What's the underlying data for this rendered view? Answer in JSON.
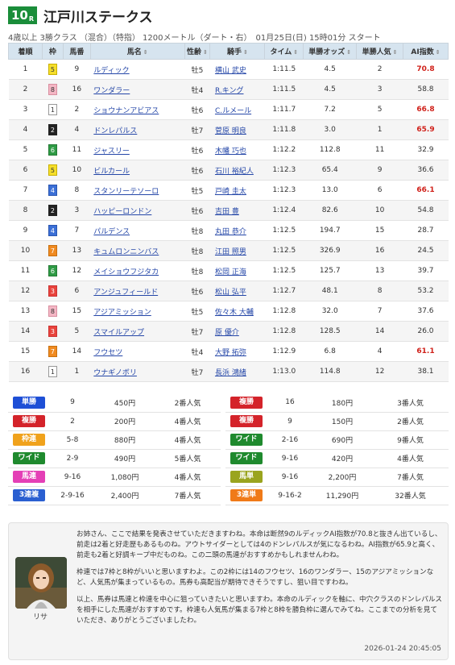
{
  "race": {
    "number": "10",
    "number_suffix": "R",
    "title": "江戸川ステークス",
    "info": "4歳以上 3勝クラス （混合）（特指） 1200メートル（ダート・右）　01月25日(日) 15時01分 スタート"
  },
  "table": {
    "headers": [
      "着順",
      "枠",
      "馬番",
      "馬名",
      "性齢",
      "騎手",
      "タイム",
      "単勝オッズ",
      "単勝人気",
      "AI指数"
    ],
    "sort_icon": "⇕",
    "rows": [
      {
        "pos": "1",
        "waku": "5",
        "num": "9",
        "name": "ルディック",
        "sex": "牡5",
        "jockey": "横山 武史",
        "time": "1:11.5",
        "odds": "4.5",
        "pop": "2",
        "ai": "70.8",
        "hi": true
      },
      {
        "pos": "2",
        "waku": "8",
        "num": "16",
        "name": "ワンダラー",
        "sex": "牡4",
        "jockey": "R.キング",
        "time": "1:11.5",
        "odds": "4.5",
        "pop": "3",
        "ai": "58.8",
        "hi": false
      },
      {
        "pos": "3",
        "waku": "1",
        "num": "2",
        "name": "ショウナンアビアス",
        "sex": "牡6",
        "jockey": "C.ルメール",
        "time": "1:11.7",
        "odds": "7.2",
        "pop": "5",
        "ai": "66.8",
        "hi": true
      },
      {
        "pos": "4",
        "waku": "2",
        "num": "4",
        "name": "ドンレパルス",
        "sex": "牡7",
        "jockey": "菅原 明良",
        "time": "1:11.8",
        "odds": "3.0",
        "pop": "1",
        "ai": "65.9",
        "hi": true
      },
      {
        "pos": "5",
        "waku": "6",
        "num": "11",
        "name": "ジャスリー",
        "sex": "牡6",
        "jockey": "木幡 巧也",
        "time": "1:12.2",
        "odds": "112.8",
        "pop": "11",
        "ai": "32.9",
        "hi": false
      },
      {
        "pos": "6",
        "waku": "5",
        "num": "10",
        "name": "ビルカール",
        "sex": "牡6",
        "jockey": "石川 裕紀人",
        "time": "1:12.3",
        "odds": "65.4",
        "pop": "9",
        "ai": "36.6",
        "hi": false
      },
      {
        "pos": "7",
        "waku": "4",
        "num": "8",
        "name": "スタンリーテソーロ",
        "sex": "牡5",
        "jockey": "戸崎 圭太",
        "time": "1:12.3",
        "odds": "13.0",
        "pop": "6",
        "ai": "66.1",
        "hi": true
      },
      {
        "pos": "8",
        "waku": "2",
        "num": "3",
        "name": "ハッピーロンドン",
        "sex": "牡6",
        "jockey": "吉田 豊",
        "time": "1:12.4",
        "odds": "82.6",
        "pop": "10",
        "ai": "54.8",
        "hi": false
      },
      {
        "pos": "9",
        "waku": "4",
        "num": "7",
        "name": "パルデンス",
        "sex": "牡8",
        "jockey": "丸田 恭介",
        "time": "1:12.5",
        "odds": "194.7",
        "pop": "15",
        "ai": "28.7",
        "hi": false
      },
      {
        "pos": "10",
        "waku": "7",
        "num": "13",
        "name": "キュムロンニンバス",
        "sex": "牡8",
        "jockey": "江田 照男",
        "time": "1:12.5",
        "odds": "326.9",
        "pop": "16",
        "ai": "24.5",
        "hi": false
      },
      {
        "pos": "11",
        "waku": "6",
        "num": "12",
        "name": "メイショウフジタカ",
        "sex": "牡8",
        "jockey": "松岡 正海",
        "time": "1:12.5",
        "odds": "125.7",
        "pop": "13",
        "ai": "39.7",
        "hi": false
      },
      {
        "pos": "12",
        "waku": "3",
        "num": "6",
        "name": "アンジュフィールド",
        "sex": "牡6",
        "jockey": "松山 弘平",
        "time": "1:12.7",
        "odds": "48.1",
        "pop": "8",
        "ai": "53.2",
        "hi": false
      },
      {
        "pos": "13",
        "waku": "8",
        "num": "15",
        "name": "アジアミッション",
        "sex": "牡5",
        "jockey": "佐々木 大輔",
        "time": "1:12.8",
        "odds": "32.0",
        "pop": "7",
        "ai": "37.6",
        "hi": false
      },
      {
        "pos": "14",
        "waku": "3",
        "num": "5",
        "name": "スマイルアップ",
        "sex": "牡7",
        "jockey": "原 優介",
        "time": "1:12.8",
        "odds": "128.5",
        "pop": "14",
        "ai": "26.0",
        "hi": false
      },
      {
        "pos": "15",
        "waku": "7",
        "num": "14",
        "name": "フウセツ",
        "sex": "牡4",
        "jockey": "大野 拓弥",
        "time": "1:12.9",
        "odds": "6.8",
        "pop": "4",
        "ai": "61.1",
        "hi": true
      },
      {
        "pos": "16",
        "waku": "1",
        "num": "1",
        "name": "ウナギノボリ",
        "sex": "牡7",
        "jockey": "長浜 鴻緒",
        "time": "1:13.0",
        "odds": "114.8",
        "pop": "12",
        "ai": "38.1",
        "hi": false
      }
    ]
  },
  "payouts": [
    [
      {
        "type": "単勝",
        "color": "#1e4fd6",
        "combo": "9",
        "amount": "450円",
        "pop": "2番人気"
      },
      {
        "type": "複勝",
        "color": "#d4232a",
        "combo": "16",
        "amount": "180円",
        "pop": "3番人気"
      }
    ],
    [
      {
        "type": "複勝",
        "color": "#d4232a",
        "combo": "2",
        "amount": "200円",
        "pop": "4番人気"
      },
      {
        "type": "複勝",
        "color": "#d4232a",
        "combo": "9",
        "amount": "150円",
        "pop": "2番人気"
      }
    ],
    [
      {
        "type": "枠連",
        "color": "#f0a21c",
        "combo": "5-8",
        "amount": "880円",
        "pop": "4番人気"
      },
      {
        "type": "ワイド",
        "color": "#1f8a2e",
        "combo": "2-16",
        "amount": "690円",
        "pop": "9番人気"
      }
    ],
    [
      {
        "type": "ワイド",
        "color": "#1f8a2e",
        "combo": "2-9",
        "amount": "490円",
        "pop": "5番人気"
      },
      {
        "type": "ワイド",
        "color": "#1f8a2e",
        "combo": "9-16",
        "amount": "420円",
        "pop": "4番人気"
      }
    ],
    [
      {
        "type": "馬連",
        "color": "#e43fb6",
        "combo": "9-16",
        "amount": "1,080円",
        "pop": "4番人気"
      },
      {
        "type": "馬単",
        "color": "#9aa41e",
        "combo": "9-16",
        "amount": "2,200円",
        "pop": "7番人気"
      }
    ],
    [
      {
        "type": "3連複",
        "color": "#2a5fd1",
        "combo": "2-9-16",
        "amount": "2,400円",
        "pop": "7番人気"
      },
      {
        "type": "3連単",
        "color": "#f07a18",
        "combo": "9-16-2",
        "amount": "11,290円",
        "pop": "32番人気"
      }
    ]
  ],
  "commentary": {
    "avatar_name": "リサ",
    "paragraphs": [
      "お姉さん、ここで結果を発表させていただきますわね。本命は断然9のルディックAI指数が70.8と抜きん出ているし、前走は2着と好走歴もあるものね。アウトサイダーとしては4のドンレパルスが気になるわね。AI指数が65.9と高く、前走も2着と好調キープ中だものね。この二頭の馬連がおすすめかもしれませんわね。",
      "枠連では7枠と8枠がいいと思いますわよ。この2枠には14のフウセツ、16のワンダラー、15のアジアミッションなど、人気馬が集まっているもの。馬券も高配当が期待できそうですし、狙い目ですわね。",
      "以上、馬券は馬連と枠連を中心に狙っていきたいと思いますわ。本命のルディックを軸に、中穴クラスのドンレパルスを相手にした馬連がおすすめです。枠連も人気馬が集まる7枠と8枠を勝負枠に選んでみてね。ここまでの分析を見ていただき、ありがとうございましたわ。"
    ],
    "timestamp": "2026-01-24 20:45:05"
  }
}
